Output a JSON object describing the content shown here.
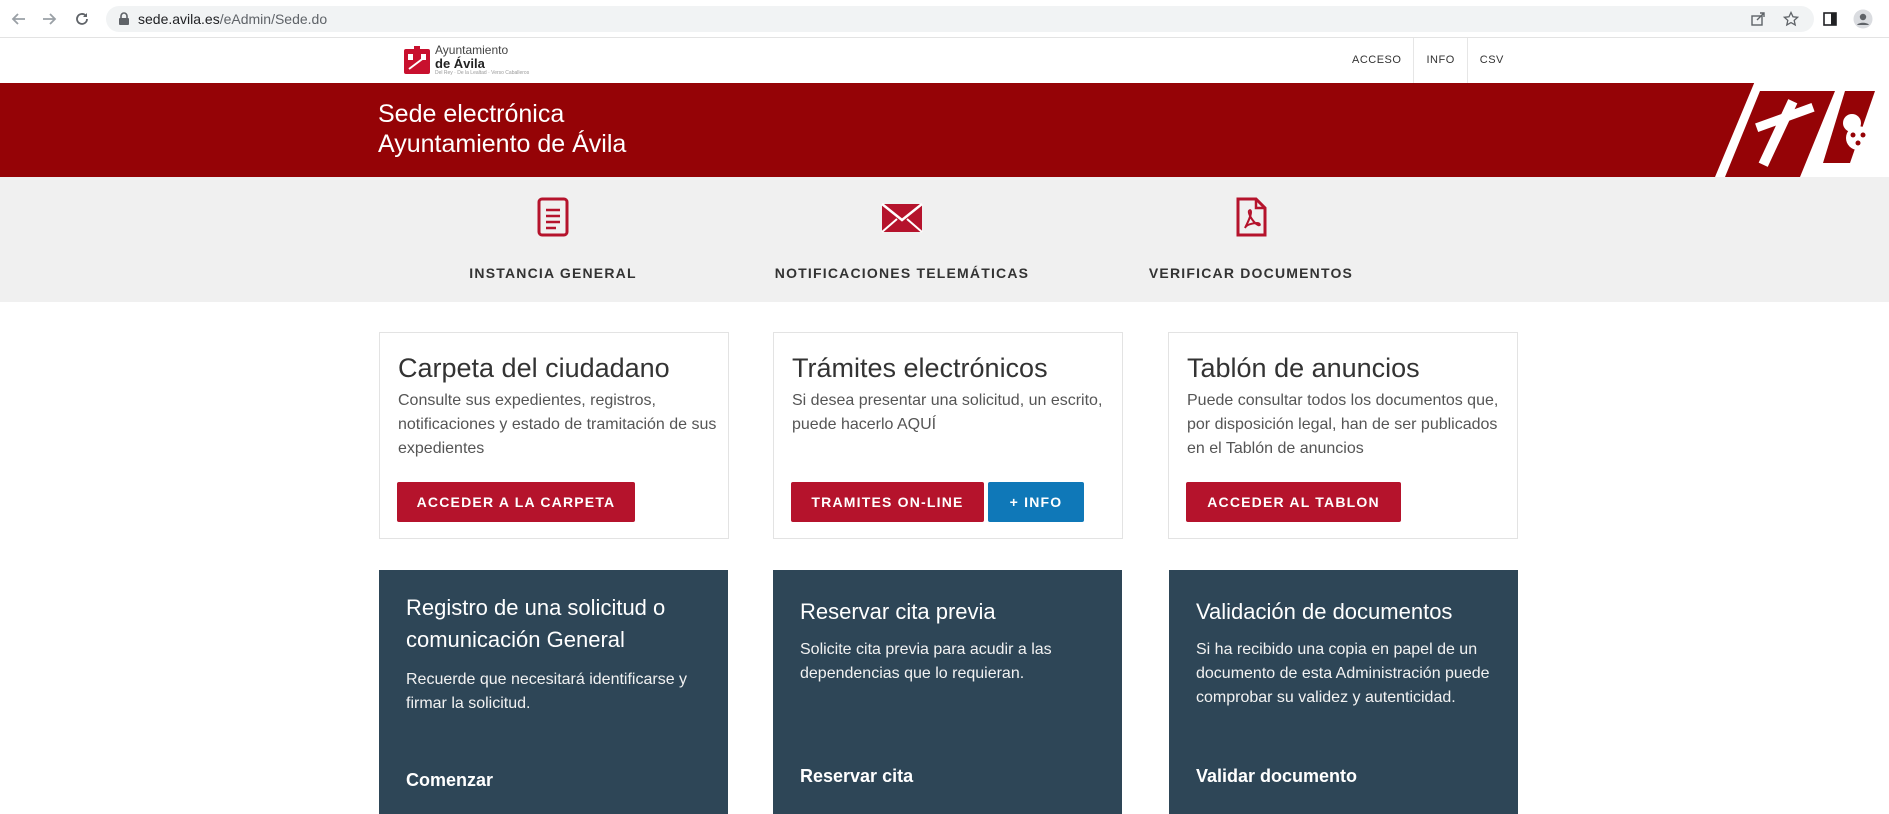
{
  "browser": {
    "url_host": "sede.avila.es",
    "url_path": "/eAdmin/Sede.do"
  },
  "header": {
    "logo_line1": "Ayuntamiento",
    "logo_line2": "de Ávila",
    "logo_tagline": "Del Rey · De la Lealtad · Verso Caballeros",
    "nav": [
      "ACCESO",
      "INFO",
      "CSV"
    ]
  },
  "banner": {
    "line1": "Sede electrónica",
    "line2": "Ayuntamiento de Ávila"
  },
  "quick": [
    {
      "label": "INSTANCIA GENERAL",
      "icon": "document-icon"
    },
    {
      "label": "NOTIFICACIONES TELEMÁTICAS",
      "icon": "envelope-icon"
    },
    {
      "label": "VERIFICAR DOCUMENTOS",
      "icon": "pdf-icon"
    }
  ],
  "cards": [
    {
      "title": "Carpeta del ciudadano",
      "text": "Consulte sus expedientes, registros, notificaciones y estado de tramitación de sus expedientes",
      "button": "ACCEDER A LA CARPETA"
    },
    {
      "title": "Trámites electrónicos",
      "text": "Si desea presentar una solicitud, un escrito, puede hacerlo AQUÍ",
      "button": "TRAMITES ON-LINE",
      "button2": "+ INFO"
    },
    {
      "title": "Tablón de anuncios",
      "text": "Puede consultar todos los documentos que, por disposición legal, han de ser publicados en el Tablón de anuncios",
      "button": "ACCEDER AL TABLON"
    }
  ],
  "panels": [
    {
      "title": "Registro de una solicitud o comunicación General",
      "text": "Recuerde que necesitará identificarse y firmar la solicitud.",
      "action": "Comenzar"
    },
    {
      "title": "Reservar cita previa",
      "text": "Solicite cita previa para acudir a las dependencias que lo requieran.",
      "action": "Reservar cita"
    },
    {
      "title": "Validación de documentos",
      "text": "Si ha recibido una copia en papel de un documento de esta Administración puede comprobar su validez y autenticidad.",
      "action": "Validar documento"
    }
  ],
  "colors": {
    "banner": "#950306",
    "button_red": "#b5132c",
    "button_blue": "#0f78b8",
    "panel": "#2e4657",
    "icon_red": "#b5132c"
  }
}
